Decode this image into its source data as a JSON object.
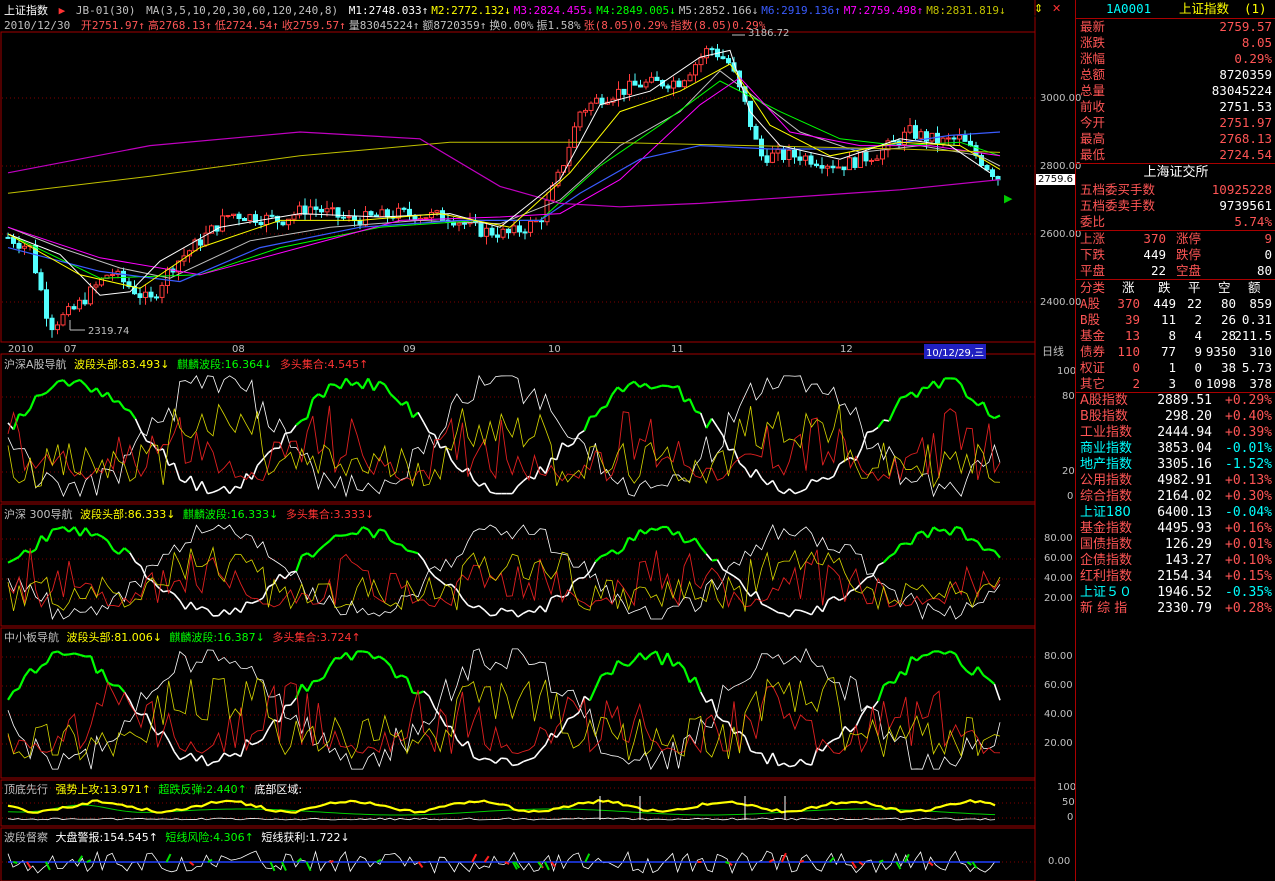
{
  "header": {
    "title": "上证指数",
    "indicator": "JB-01(30)",
    "ma_params": "MA(3,5,10,20,30,60,120,240,8)",
    "ma_values": [
      {
        "label": "M1:2748.033↑",
        "color": "#ffffff"
      },
      {
        "label": "M2:2772.132↓",
        "color": "#ffff00"
      },
      {
        "label": "M3:2824.455↓",
        "color": "#ff00ff"
      },
      {
        "label": "M4:2849.005↓",
        "color": "#00ff00"
      },
      {
        "label": "M5:2852.166↓",
        "color": "#c0c0c0"
      },
      {
        "label": "M6:2919.136↑",
        "color": "#3a5cff"
      },
      {
        "label": "M7:2759.498↑",
        "color": "#ff00ff"
      },
      {
        "label": "M8:2831.819↓",
        "color": "#c0c000"
      }
    ],
    "date": "2010/12/30",
    "ohlc": [
      {
        "label": "开2751.97↑",
        "color": "#ff5555"
      },
      {
        "label": "高2768.13↑",
        "color": "#ff5555"
      },
      {
        "label": "低2724.54↑",
        "color": "#ff5555"
      },
      {
        "label": "收2759.57↑",
        "color": "#ff5555"
      },
      {
        "label": "量83045224↑",
        "color": "#c0c0c0"
      },
      {
        "label": "额8720359↑",
        "color": "#c0c0c0"
      },
      {
        "label": "换0.00%",
        "color": "#c0c0c0"
      },
      {
        "label": "振1.58%",
        "color": "#c0c0c0"
      },
      {
        "label": "张(8.05)0.29%",
        "color": "#ff5555"
      },
      {
        "label": "指数(8.05)0.29%",
        "color": "#ff5555"
      }
    ]
  },
  "main_chart": {
    "price_axis": [
      "3000.00",
      "2800.00",
      "2600.00",
      "2400.00"
    ],
    "high_mark": "3186.72",
    "low_mark": "2319.74",
    "current_price_tag": "2759.6",
    "x_labels": [
      "2010",
      "07",
      "08",
      "09",
      "10",
      "11",
      "12"
    ],
    "cursor_date": "10/12/29,三",
    "period": "日线"
  },
  "panels": [
    {
      "title": "沪深A股导航",
      "items": [
        {
          "label": "波段头部:83.493↓",
          "color": "#ffff00"
        },
        {
          "label": "麒麟波段:16.364↓",
          "color": "#00ff00"
        },
        {
          "label": "多头集合:4.545↑",
          "color": "#ff3333"
        }
      ],
      "axis": [
        "100",
        "80",
        "20",
        "0"
      ]
    },
    {
      "title": "沪深 300导航",
      "items": [
        {
          "label": "波段头部:86.333↓",
          "color": "#ffff00"
        },
        {
          "label": "麒麟波段:16.333↓",
          "color": "#00ff00"
        },
        {
          "label": "多头集合:3.333↓",
          "color": "#ff3333"
        }
      ],
      "axis": [
        "80.00",
        "60.00",
        "40.00",
        "20.00"
      ]
    },
    {
      "title": "中小板导航",
      "items": [
        {
          "label": "波段头部:81.006↓",
          "color": "#ffff00"
        },
        {
          "label": "麒麟波段:16.387↓",
          "color": "#00ff00"
        },
        {
          "label": "多头集合:3.724↑",
          "color": "#ff3333"
        }
      ],
      "axis": [
        "80.00",
        "60.00",
        "40.00",
        "20.00"
      ]
    },
    {
      "title": "顶底先行",
      "items": [
        {
          "label": "强势上攻:13.971↑",
          "color": "#ffff00"
        },
        {
          "label": "超跌反弹:2.440↑",
          "color": "#00ff00"
        },
        {
          "label": "底部区域:",
          "color": "#ffffff"
        }
      ],
      "axis": [
        "100",
        "50",
        "0"
      ]
    },
    {
      "title": "波段督察",
      "items": [
        {
          "label": "大盘警报:154.545↑",
          "color": "#ffffff"
        },
        {
          "label": "短线风险:4.306↑",
          "color": "#00ff00"
        },
        {
          "label": "短线获利:1.722↓",
          "color": "#ffffff"
        }
      ],
      "axis": [
        "0.00"
      ]
    }
  ],
  "sidebar": {
    "code": "1A0001",
    "name": "上证指数",
    "page": "(1)",
    "quotes": [
      {
        "k": "最新",
        "v": "2759.57",
        "c": "#ff5555"
      },
      {
        "k": "涨跌",
        "v": "8.05",
        "c": "#ff5555"
      },
      {
        "k": "涨幅",
        "v": "0.29%",
        "c": "#ff5555"
      },
      {
        "k": "总额",
        "v": "8720359",
        "c": "#ffffff"
      },
      {
        "k": "总量",
        "v": "83045224",
        "c": "#ffffff"
      },
      {
        "k": "前收",
        "v": "2751.53",
        "c": "#ffffff"
      },
      {
        "k": "今开",
        "v": "2751.97",
        "c": "#ff5555"
      },
      {
        "k": "最高",
        "v": "2768.13",
        "c": "#ff5555"
      },
      {
        "k": "最低",
        "v": "2724.54",
        "c": "#ff5555"
      }
    ],
    "exchange": "上海证交所",
    "book": [
      {
        "k": "五档委买手数",
        "v": "10925228",
        "c": "#ff5555"
      },
      {
        "k": "五档委卖手数",
        "v": "9739561",
        "c": "#ffffff"
      },
      {
        "k": "委比",
        "v": "5.74%",
        "c": "#ff5555"
      }
    ],
    "breadth": [
      {
        "k1": "上涨",
        "v1": "370",
        "c1": "#ff5555",
        "k2": "涨停",
        "v2": "9",
        "c2": "#ff5555"
      },
      {
        "k1": "下跌",
        "v1": "449",
        "c1": "#ffffff",
        "k2": "跌停",
        "v2": "0",
        "c2": "#ffffff"
      },
      {
        "k1": "平盘",
        "v1": "22",
        "c1": "#ffffff",
        "k2": "空盘",
        "v2": "80",
        "c2": "#ffffff"
      }
    ],
    "category_header": [
      "分类",
      "涨",
      "跌",
      "平",
      "空",
      "额"
    ],
    "categories": [
      {
        "name": "A股",
        "up": "370",
        "down": "449",
        "flat": "22",
        "empty": "80",
        "amt": "859"
      },
      {
        "name": "B股",
        "up": "39",
        "down": "11",
        "flat": "2",
        "empty": "26",
        "amt": "0.31"
      },
      {
        "name": "基金",
        "up": "13",
        "down": "8",
        "flat": "4",
        "empty": "28",
        "amt": "211.5"
      },
      {
        "name": "债券",
        "up": "110",
        "down": "77",
        "flat": "9",
        "empty": "9350",
        "amt": "310"
      },
      {
        "name": "权证",
        "up": "0",
        "down": "1",
        "flat": "0",
        "empty": "38",
        "amt": "5.73"
      },
      {
        "name": "其它",
        "up": "2",
        "down": "3",
        "flat": "0",
        "empty": "1098",
        "amt": "378"
      }
    ],
    "indices": [
      {
        "n": "A股指数",
        "p": "2889.51",
        "c": "+0.29%",
        "nc": "#ff5555",
        "cc": "#ff5555"
      },
      {
        "n": "B股指数",
        "p": "298.20",
        "c": "+0.40%",
        "nc": "#ff5555",
        "cc": "#ff5555"
      },
      {
        "n": "工业指数",
        "p": "2444.94",
        "c": "+0.39%",
        "nc": "#ff5555",
        "cc": "#ff5555"
      },
      {
        "n": "商业指数",
        "p": "3853.04",
        "c": "-0.01%",
        "nc": "#00ffff",
        "cc": "#00ffff"
      },
      {
        "n": "地产指数",
        "p": "3305.16",
        "c": "-1.52%",
        "nc": "#00ffff",
        "cc": "#00ffff"
      },
      {
        "n": "公用指数",
        "p": "4982.91",
        "c": "+0.13%",
        "nc": "#ff5555",
        "cc": "#ff5555"
      },
      {
        "n": "综合指数",
        "p": "2164.02",
        "c": "+0.30%",
        "nc": "#ff5555",
        "cc": "#ff5555"
      },
      {
        "n": "上证180",
        "p": "6400.13",
        "c": "-0.04%",
        "nc": "#00ffff",
        "cc": "#00ffff"
      },
      {
        "n": "基金指数",
        "p": "4495.93",
        "c": "+0.16%",
        "nc": "#ff5555",
        "cc": "#ff5555"
      },
      {
        "n": "国债指数",
        "p": "126.29",
        "c": "+0.01%",
        "nc": "#ff5555",
        "cc": "#ff5555"
      },
      {
        "n": "企债指数",
        "p": "143.27",
        "c": "+0.10%",
        "nc": "#ff5555",
        "cc": "#ff5555"
      },
      {
        "n": "红利指数",
        "p": "2154.34",
        "c": "+0.15%",
        "nc": "#ff5555",
        "cc": "#ff5555"
      },
      {
        "n": "上证５０",
        "p": "1946.52",
        "c": "-0.35%",
        "nc": "#00ffff",
        "cc": "#00ffff"
      },
      {
        "n": "新 综 指",
        "p": "2330.79",
        "c": "+0.28%",
        "nc": "#ff5555",
        "cc": "#ff5555"
      }
    ]
  }
}
